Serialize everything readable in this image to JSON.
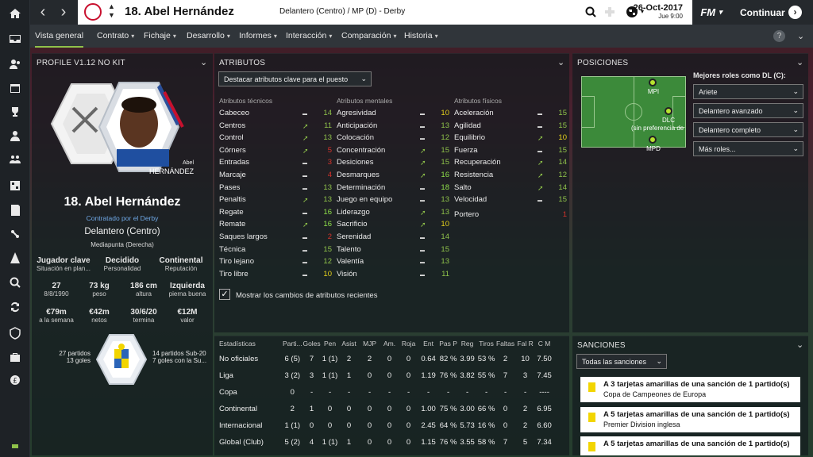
{
  "header": {
    "player_title": "18. Abel Hernández",
    "position_club": "Delantero (Centro) / MP (D) - Derby",
    "date": "26-Oct-2017",
    "day_time": "Jue 9:00",
    "logo_text": "FM",
    "continue_label": "Continuar"
  },
  "menu": {
    "tabs": [
      {
        "label": "Vista general"
      },
      {
        "label": "Contrato"
      },
      {
        "label": "Fichaje"
      },
      {
        "label": "Desarrollo"
      },
      {
        "label": "Informes"
      },
      {
        "label": "Interacción"
      },
      {
        "label": "Comparación"
      },
      {
        "label": "Historia"
      }
    ],
    "help_label": "?"
  },
  "profile": {
    "panel_title": "PROFILE V1.12 NO KIT",
    "card_first": "Abel",
    "card_last": "HERNÁNDEZ",
    "name": "18. Abel Hernández",
    "contracted": "Contratado por el Derby",
    "position": "Delantero (Centro)",
    "subposition": "Mediapunta (Derecha)",
    "info": [
      {
        "value": "Jugador clave",
        "label": "Situación en plan..."
      },
      {
        "value": "Decidido",
        "label": "Personalidad"
      },
      {
        "value": "Continental",
        "label": "Reputación"
      }
    ],
    "stats": [
      {
        "value": "27",
        "label": "8/8/1990"
      },
      {
        "value": "73 kg",
        "label": "peso"
      },
      {
        "value": "186 cm",
        "label": "altura"
      },
      {
        "value": "Izquierda",
        "label": "pierna buena"
      }
    ],
    "money": [
      {
        "value": "€79m",
        "label": "a la semana"
      },
      {
        "value": "€42m",
        "label": "netos"
      },
      {
        "value": "30/6/20",
        "label": "termina"
      },
      {
        "value": "€12M",
        "label": "valor"
      }
    ],
    "national_left": {
      "line1": "27 partidos",
      "line2": "13 goles"
    },
    "national_right": {
      "line1": "14 partidos Sub-20",
      "line2": "7 goles con la Su..."
    }
  },
  "attributes": {
    "panel_title": "ATRIBUTOS",
    "highlight_dropdown": "Destacar atributos clave para el puesto",
    "tech_header": "Atributos técnicos",
    "mental_header": "Atributos mentales",
    "phys_header": "Atributos físicos",
    "technical": [
      {
        "name": "Cabeceo",
        "trend": "flat",
        "value": "14"
      },
      {
        "name": "Centros",
        "trend": "up",
        "value": "11"
      },
      {
        "name": "Control",
        "trend": "up",
        "value": "13"
      },
      {
        "name": "Córners",
        "trend": "up",
        "value": "5"
      },
      {
        "name": "Entradas",
        "trend": "flat",
        "value": "3"
      },
      {
        "name": "Marcaje",
        "trend": "flat",
        "value": "4"
      },
      {
        "name": "Pases",
        "trend": "flat",
        "value": "13"
      },
      {
        "name": "Penaltis",
        "trend": "up",
        "value": "13"
      },
      {
        "name": "Regate",
        "trend": "flat",
        "value": "16"
      },
      {
        "name": "Remate",
        "trend": "up",
        "value": "16"
      },
      {
        "name": "Saques largos",
        "trend": "flat",
        "value": "2"
      },
      {
        "name": "Técnica",
        "trend": "flat",
        "value": "15"
      },
      {
        "name": "Tiro lejano",
        "trend": "flat",
        "value": "12"
      },
      {
        "name": "Tiro libre",
        "trend": "flat",
        "value": "10"
      }
    ],
    "mental": [
      {
        "name": "Agresividad",
        "trend": "flat",
        "value": "10"
      },
      {
        "name": "Anticipación",
        "trend": "flat",
        "value": "13"
      },
      {
        "name": "Colocación",
        "trend": "flat",
        "value": "12"
      },
      {
        "name": "Concentración",
        "trend": "up",
        "value": "15"
      },
      {
        "name": "Desiciones",
        "trend": "up",
        "value": "15"
      },
      {
        "name": "Desmarques",
        "trend": "up",
        "value": "16"
      },
      {
        "name": "Determinación",
        "trend": "flat",
        "value": "18"
      },
      {
        "name": "Juego en equipo",
        "trend": "flat",
        "value": "13"
      },
      {
        "name": "Liderazgo",
        "trend": "up",
        "value": "13"
      },
      {
        "name": "Sacrificio",
        "trend": "up",
        "value": "10"
      },
      {
        "name": "Serenidad",
        "trend": "flat",
        "value": "14"
      },
      {
        "name": "Talento",
        "trend": "flat",
        "value": "15"
      },
      {
        "name": "Valentía",
        "trend": "flat",
        "value": "13"
      },
      {
        "name": "Visión",
        "trend": "flat",
        "value": "11"
      }
    ],
    "physical": [
      {
        "name": "Aceleración",
        "trend": "flat",
        "value": "15"
      },
      {
        "name": "Agilidad",
        "trend": "flat",
        "value": "15"
      },
      {
        "name": "Equilibrio",
        "trend": "up",
        "value": "10"
      },
      {
        "name": "Fuerza",
        "trend": "flat",
        "value": "15"
      },
      {
        "name": "Recuperación",
        "trend": "up",
        "value": "14"
      },
      {
        "name": "Resistencia",
        "trend": "up",
        "value": "12"
      },
      {
        "name": "Salto",
        "trend": "up",
        "value": "14"
      },
      {
        "name": "Velocidad",
        "trend": "flat",
        "value": "15"
      }
    ],
    "goalkeeper": {
      "name": "Portero",
      "value": "1"
    },
    "show_changes": "Mostrar los cambios de atributos recientes"
  },
  "positions": {
    "panel_title": "POSICIONES",
    "pitch_labels": {
      "mpi": "MPI",
      "dlc": "DLC",
      "nopref": "(sin preferencia de",
      "mpd": "MPD"
    },
    "roles_title": "Mejores roles como DL (C):",
    "roles": [
      {
        "label": "Ariete"
      },
      {
        "label": "Delantero avanzado"
      },
      {
        "label": "Delantero completo"
      },
      {
        "label": "Más roles..."
      }
    ]
  },
  "stats": {
    "headers": [
      "Estadísticas",
      "Parti...",
      "Goles",
      "Pen",
      "Asist",
      "MJP",
      "Am.",
      "Roja",
      "Ent",
      "Pas P",
      "Reg",
      "Tiros",
      "Faltas",
      "Fal R",
      "C M"
    ],
    "rows": [
      [
        "No oficiales",
        "6 (5)",
        "7",
        "1 (1)",
        "2",
        "2",
        "0",
        "0",
        "0.64",
        "82 %",
        "3.99",
        "53 %",
        "2",
        "10",
        "7.50"
      ],
      [
        "Liga",
        "3 (2)",
        "3",
        "1 (1)",
        "1",
        "0",
        "0",
        "0",
        "1.19",
        "76 %",
        "3.82",
        "55 %",
        "7",
        "3",
        "7.45"
      ],
      [
        "Copa",
        "0",
        "-",
        "-",
        "-",
        "-",
        "-",
        "-",
        "-",
        "-",
        "-",
        "-",
        "-",
        "-",
        "----"
      ],
      [
        "Continental",
        "2",
        "1",
        "0",
        "0",
        "0",
        "0",
        "0",
        "1.00",
        "75 %",
        "3.00",
        "66 %",
        "0",
        "2",
        "6.95"
      ],
      [
        "Internacional",
        "1 (1)",
        "0",
        "0",
        "0",
        "0",
        "0",
        "0",
        "2.45",
        "64 %",
        "5.73",
        "16 %",
        "0",
        "2",
        "6.60"
      ],
      [
        "Global (Club)",
        "5 (2)",
        "4",
        "1 (1)",
        "1",
        "0",
        "0",
        "0",
        "1.15",
        "76 %",
        "3.55",
        "58 %",
        "7",
        "5",
        "7.34"
      ]
    ]
  },
  "sanctions": {
    "panel_title": "SANCIONES",
    "filter": "Todas las sanciones",
    "items": [
      {
        "title": "A 3 tarjetas amarillas de una sanción de 1 partido(s)",
        "comp": "Copa de Campeones de Europa"
      },
      {
        "title": "A 5 tarjetas amarillas de una sanción de 1 partido(s)",
        "comp": "Premier Division inglesa"
      },
      {
        "title": "A 5 tarjetas amarillas de una sanción de 1 partido(s)",
        "comp": ""
      }
    ]
  },
  "colors": {
    "accent": "#8fc24a",
    "green": "#8fc24a",
    "yellow": "#e6d21c",
    "red": "#d6332b"
  }
}
